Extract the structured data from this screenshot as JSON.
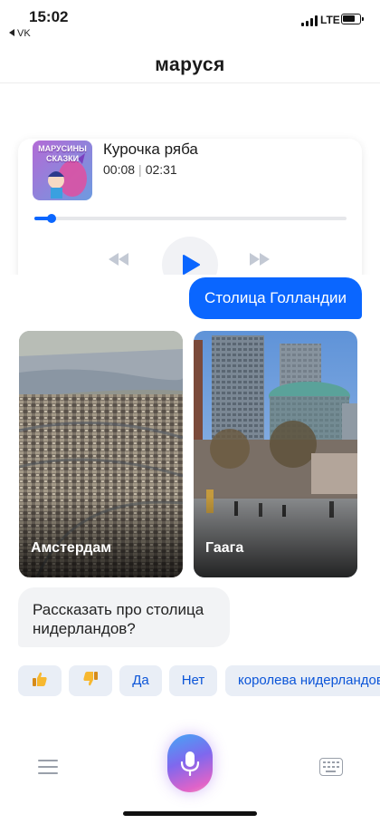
{
  "status_bar": {
    "time": "15:02",
    "back_app": "VK",
    "network": "LTE"
  },
  "header": {
    "title": "маруся"
  },
  "player": {
    "cover_text": "МАРУСИНЫ СКАЗКИ",
    "track_title": "Курочка ряба",
    "elapsed": "00:08",
    "separator": "|",
    "duration": "02:31",
    "progress_fraction": 0.055,
    "accent_color": "#0a66ff"
  },
  "chat": {
    "user_message": "Столица Голландии",
    "cards": [
      {
        "caption": "Амстердам"
      },
      {
        "caption": "Гаага"
      }
    ],
    "bot_message": "Рассказать про столица нидерландов?"
  },
  "suggestions": {
    "like_icon": "thumbs-up-icon",
    "dislike_icon": "thumbs-down-icon",
    "yes": "Да",
    "no": "Нет",
    "queen": "королева нидерландов"
  },
  "bottom_bar": {
    "menu_icon": "menu-icon",
    "mic_icon": "microphone-icon",
    "keyboard_icon": "keyboard-icon"
  }
}
